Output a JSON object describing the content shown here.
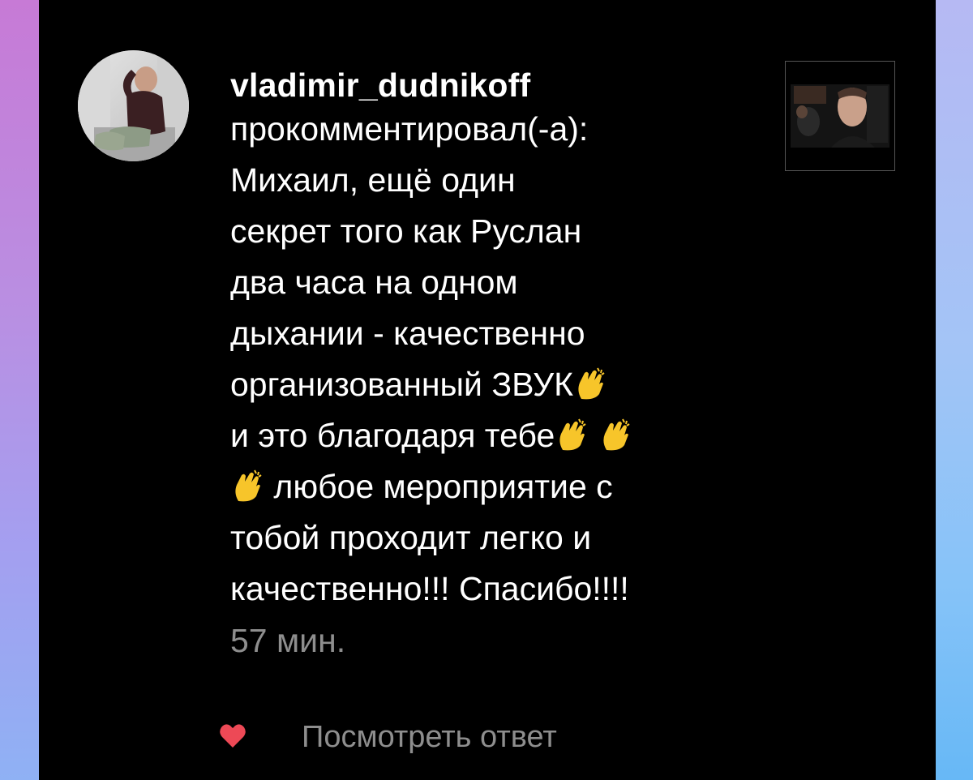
{
  "notification": {
    "username": "vladimir_dudnikoff",
    "action": "прокомментировал(-а):",
    "comment_lines": [
      "Михаил, ещё один",
      "секрет того как Руслан",
      "два часа на одном",
      "дыхании - качественно",
      "организованный ЗВУК",
      "и это благодаря тебе",
      "любое мероприятие с",
      "тобой проходит легко и",
      "качественно!!! Спасибо!!!!"
    ],
    "timestamp": "57 мин.",
    "view_reply_label": "Посмотреть ответ"
  },
  "icons": {
    "like": "heart-icon",
    "clap": "clapping-hands-emoji"
  },
  "colors": {
    "background": "#000000",
    "text": "#ffffff",
    "secondary_text": "#8e8e8e",
    "heart": "#ed4956",
    "emoji": "#f7c52a"
  }
}
